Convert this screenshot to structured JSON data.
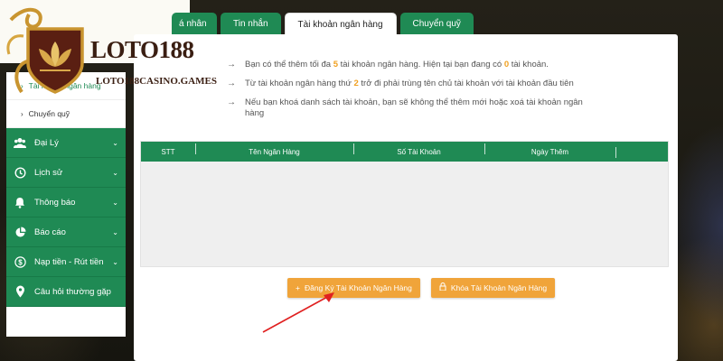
{
  "brand": {
    "name": "LOTO188",
    "domain": "LOTO188CASINO.GAMES"
  },
  "tabs": [
    {
      "label": "á nhân",
      "active": false
    },
    {
      "label": "Tin nhắn",
      "active": false
    },
    {
      "label": "Tài khoản ngân hàng",
      "active": true
    },
    {
      "label": "Chuyển quỹ",
      "active": false
    }
  ],
  "info": {
    "line1_a": "Bạn có thể thêm tối đa",
    "line1_max": "5",
    "line1_b": "tài khoản ngân hàng. Hiện tại bạn đang có",
    "line1_count": "0",
    "line1_c": "tài khoản.",
    "line2_a": "Từ tài khoản ngân hàng thứ",
    "line2_num": "2",
    "line2_b": "trở đi phải trùng tên chủ tài khoản với tài khoản đầu tiên",
    "line3": "Nếu bạn khoá danh sách tài khoản, bạn sẽ không thể thêm mới hoặc xoá tài khoản ngân hàng"
  },
  "table": {
    "headers": [
      "STT",
      "Tên Ngân Hàng",
      "Số Tài Khoản",
      "Ngày Thêm"
    ],
    "rows": []
  },
  "buttons": {
    "register": "Đăng Ký Tài Khoản Ngân Hàng",
    "lock": "Khóa Tài Khoản Ngân Hàng"
  },
  "sidebar": {
    "sub_items": [
      {
        "label": "Tài khoản ngân hàng",
        "active": true
      },
      {
        "label": "Chuyển quỹ",
        "active": false
      }
    ],
    "nav_items": [
      {
        "label": "Đại Lý",
        "icon": "users-icon",
        "has_caret": true
      },
      {
        "label": "Lịch sử",
        "icon": "history-icon",
        "has_caret": true
      },
      {
        "label": "Thông báo",
        "icon": "bell-icon",
        "has_caret": true
      },
      {
        "label": "Báo cáo",
        "icon": "pie-chart-icon",
        "has_caret": true
      },
      {
        "label": "Nạp tiền - Rút tiền",
        "icon": "dollar-icon",
        "has_caret": true
      },
      {
        "label": "Câu hỏi thường gặp",
        "icon": "location-pin-icon",
        "has_caret": false
      }
    ]
  },
  "colors": {
    "primary": "#1f8a54",
    "accent": "#f0a43a",
    "highlight": "#f0a020"
  }
}
